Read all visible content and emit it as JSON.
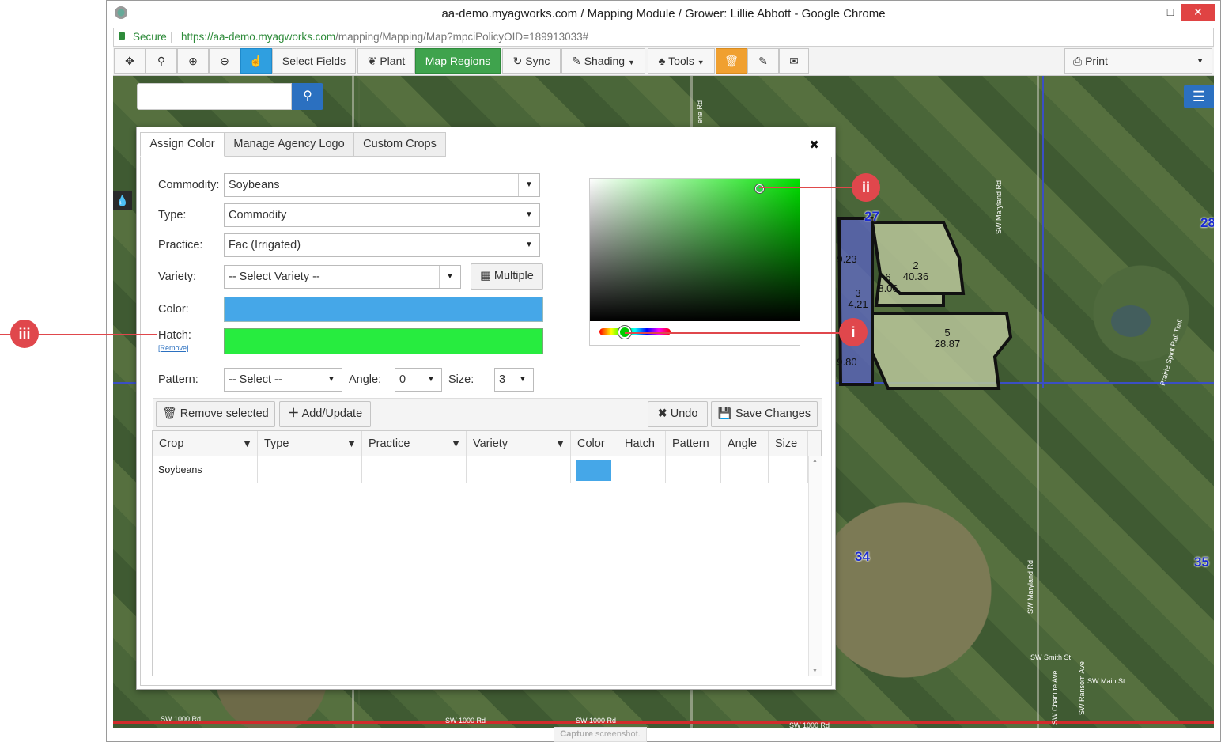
{
  "window": {
    "title": "aa-demo.myagworks.com / Mapping Module / Grower: Lillie Abbott - Google Chrome",
    "minimize": "—",
    "maximize": "□",
    "close": "✕"
  },
  "address_bar": {
    "secure_label": "Secure",
    "url_host": "https://aa-demo.myagworks.com",
    "url_path": "/mapping/Mapping/Map?mpciPolicyOID=189913033#"
  },
  "toolbar": {
    "select_fields": "Select Fields",
    "plant": "Plant",
    "map_regions": "Map Regions",
    "sync": "Sync",
    "shading": "Shading",
    "tools": "Tools",
    "print": "Print",
    "accent_green": "#3fa34d",
    "accent_blue": "#2f9fe0",
    "accent_orange": "#f0a030"
  },
  "search": {
    "value": ""
  },
  "map": {
    "labels": {
      "section_27": "27",
      "section_28": "28",
      "section_34": "34",
      "section_35": "35"
    },
    "fields": {
      "f2_num": "2",
      "f2_acres": "40.36",
      "f6_num": "6",
      "f6_acres": "8.06",
      "f5_num": "5",
      "f5_acres": "28.87",
      "f3_num": "3",
      "f3_acres": "4.21",
      "fa_acres": "9.23",
      "fb_acres": "9.80"
    },
    "roads": {
      "maryland_rd": "SW Maryland Rd",
      "maryland_rd_2": "SW Maryland Rd",
      "prairie_spirit": "Prairie Spirit Rail Trail",
      "smith_st": "SW Smith St",
      "main_st": "SW Main St",
      "chanute_ave": "SW Chanute Ave",
      "ransom_ave": "SW Ransom Ave",
      "r1000_a": "SW 1000 Rd",
      "r1000_b": "SW 1000 Rd",
      "r1000_c": "SW 1000 Rd",
      "r1000_d": "SW 1000 Rd",
      "top_rd": "ena Rd"
    }
  },
  "dialog": {
    "tabs": [
      "Assign Color",
      "Manage Agency Logo",
      "Custom Crops"
    ],
    "close": "✖",
    "form": {
      "commodity_label": "Commodity:",
      "commodity_value": "Soybeans",
      "type_label": "Type:",
      "type_value": "Commodity",
      "practice_label": "Practice:",
      "practice_value": "Fac (Irrigated)",
      "variety_label": "Variety:",
      "variety_value": "-- Select Variety --",
      "multiple_button": "Multiple",
      "color_label": "Color:",
      "color_value": "#45a7e8",
      "hatch_label": "Hatch:",
      "hatch_remove": "[Remove]",
      "hatch_value": "#27ec3f",
      "pattern_label": "Pattern:",
      "pattern_value": "-- Select --",
      "angle_label": "Angle:",
      "angle_value": "0",
      "size_label": "Size:",
      "size_value": "3"
    },
    "color_picker": {
      "hue": "#00e000"
    },
    "actions": {
      "remove_selected": "Remove selected",
      "add_update": "Add/Update",
      "undo": "Undo",
      "save_changes": "Save Changes"
    },
    "grid": {
      "columns": [
        "Crop",
        "Type",
        "Practice",
        "Variety",
        "Color",
        "Hatch",
        "Pattern",
        "Angle",
        "Size"
      ],
      "rows": [
        {
          "crop": "Soybeans",
          "type": "",
          "practice": "",
          "variety": "",
          "color": "#45a7e8",
          "hatch": "",
          "pattern": "",
          "angle": "",
          "size": ""
        }
      ]
    }
  },
  "callouts": {
    "i": "i",
    "ii": "ii",
    "iii": "iii",
    "color": "#e0474c"
  },
  "footer": {
    "capture_bold": "Capture",
    "capture_rest": " screenshot."
  }
}
